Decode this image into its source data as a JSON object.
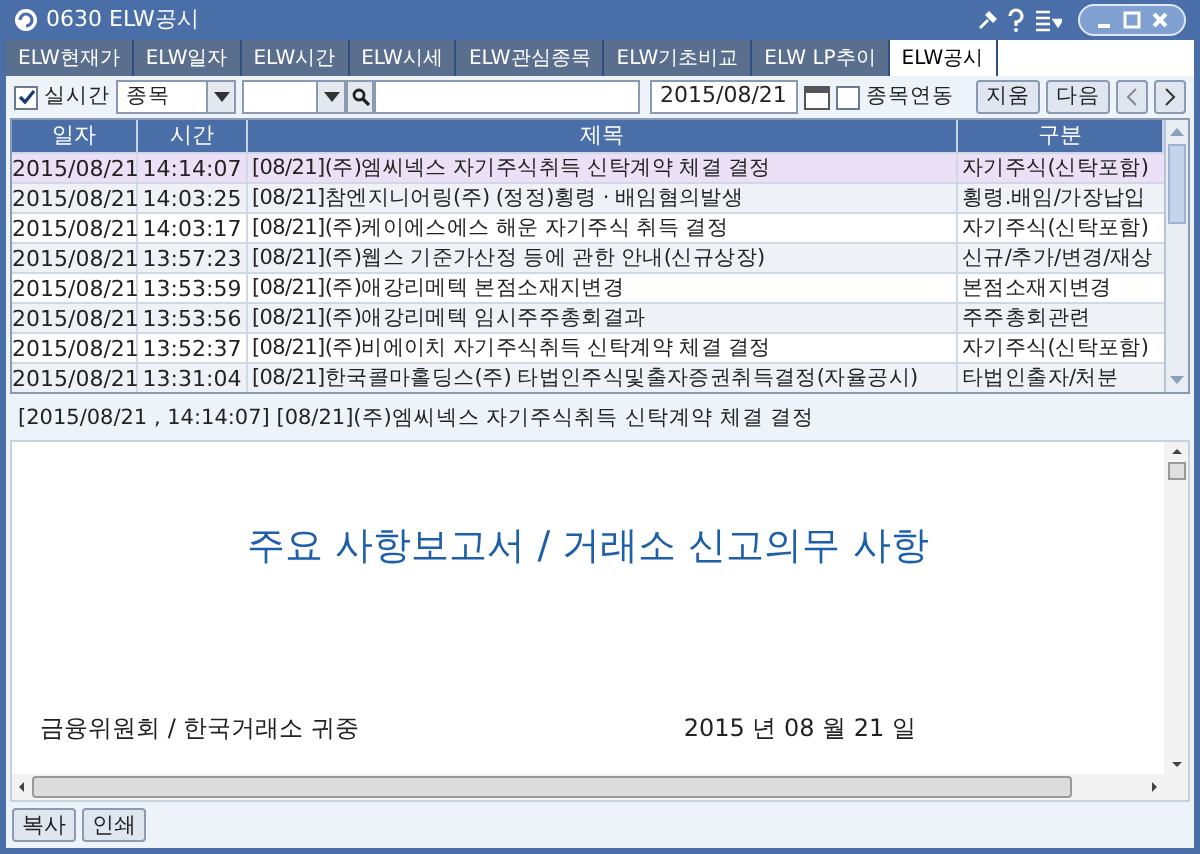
{
  "window": {
    "title": "0630 ELW공시"
  },
  "tabs": [
    {
      "label": "ELW현재가",
      "selected": false
    },
    {
      "label": "ELW일자",
      "selected": false
    },
    {
      "label": "ELW시간",
      "selected": false
    },
    {
      "label": "ELW시세",
      "selected": false
    },
    {
      "label": "ELW관심종목",
      "selected": false
    },
    {
      "label": "ELW기초비교",
      "selected": false
    },
    {
      "label": "ELW LP추이",
      "selected": false
    },
    {
      "label": "ELW공시",
      "selected": true
    }
  ],
  "toolbar": {
    "realtime": {
      "label": "실시간",
      "checked": true
    },
    "category": "종목",
    "date": "2015/08/21",
    "link": {
      "label": "종목연동",
      "checked": false
    },
    "buttons": [
      "지움",
      "다음"
    ]
  },
  "table": {
    "columns": [
      "일자",
      "시간",
      "제목",
      "구분"
    ],
    "rows": [
      {
        "date": "2015/08/21",
        "time": "14:14:07",
        "title": "[08/21](주)엠씨넥스 자기주식취득 신탁계약 체결 결정",
        "type": "자기주식(신탁포함)",
        "selected": true
      },
      {
        "date": "2015/08/21",
        "time": "14:03:25",
        "title": "[08/21]참엔지니어링(주) (정정)횡령 · 배임혐의발생",
        "type": "횡령.배임/가장납입",
        "selected": false
      },
      {
        "date": "2015/08/21",
        "time": "14:03:17",
        "title": "[08/21](주)케이에스에스 해운 자기주식 취득 결정",
        "type": "자기주식(신탁포함)",
        "selected": false
      },
      {
        "date": "2015/08/21",
        "time": "13:57:23",
        "title": "[08/21](주)웹스 기준가산정 등에 관한 안내(신규상장)",
        "type": "신규/추가/변경/재상",
        "selected": false
      },
      {
        "date": "2015/08/21",
        "time": "13:53:59",
        "title": "[08/21](주)애강리메텍 본점소재지변경",
        "type": "본점소재지변경",
        "selected": false
      },
      {
        "date": "2015/08/21",
        "time": "13:53:56",
        "title": "[08/21](주)애강리메텍 임시주주총회결과",
        "type": "주주총회관련",
        "selected": false
      },
      {
        "date": "2015/08/21",
        "time": "13:52:37",
        "title": "[08/21](주)비에이치 자기주식취득 신탁계약 체결 결정",
        "type": "자기주식(신탁포함)",
        "selected": false
      },
      {
        "date": "2015/08/21",
        "time": "13:31:04",
        "title": "[08/21]한국콜마홀딩스(주) 타법인주식및출자증권취득결정(자율공시)",
        "type": "타법인출자/처분",
        "selected": false
      }
    ]
  },
  "detail": {
    "header": "[2015/08/21 , 14:14:07] [08/21](주)엠씨넥스 자기주식취득 신탁계약 체결 결정",
    "heading": "주요 사항보고서 / 거래소 신고의무 사항",
    "addressee": "금융위원회 / 한국거래소 귀중",
    "date": "2015 년 08 월 21 일"
  },
  "bottom_buttons": [
    "복사",
    "인쇄"
  ]
}
